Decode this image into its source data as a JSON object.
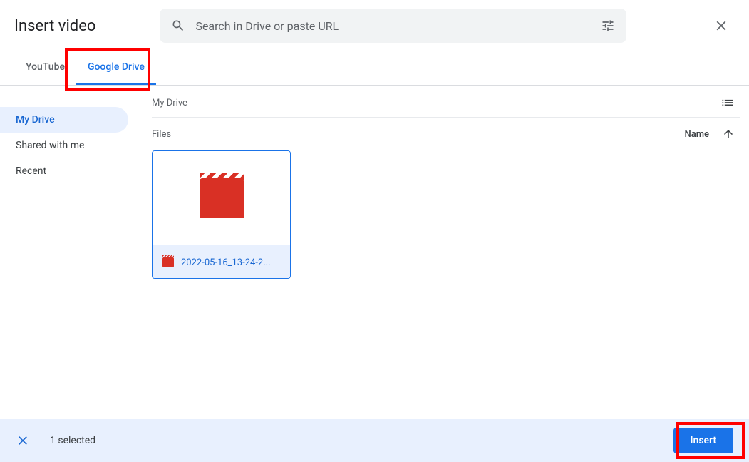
{
  "header": {
    "title": "Insert video",
    "search_placeholder": "Search in Drive or paste URL"
  },
  "tabs": [
    {
      "label": "YouTube",
      "active": false
    },
    {
      "label": "Google Drive",
      "active": true
    }
  ],
  "sidebar": {
    "items": [
      {
        "label": "My Drive",
        "active": true
      },
      {
        "label": "Shared with me",
        "active": false
      },
      {
        "label": "Recent",
        "active": false
      }
    ]
  },
  "main": {
    "breadcrumb": "My Drive",
    "files_label": "Files",
    "sort_label": "Name",
    "files": [
      {
        "name": "2022-05-16_13-24-2..."
      }
    ]
  },
  "footer": {
    "selected_text": "1 selected",
    "insert_label": "Insert"
  }
}
